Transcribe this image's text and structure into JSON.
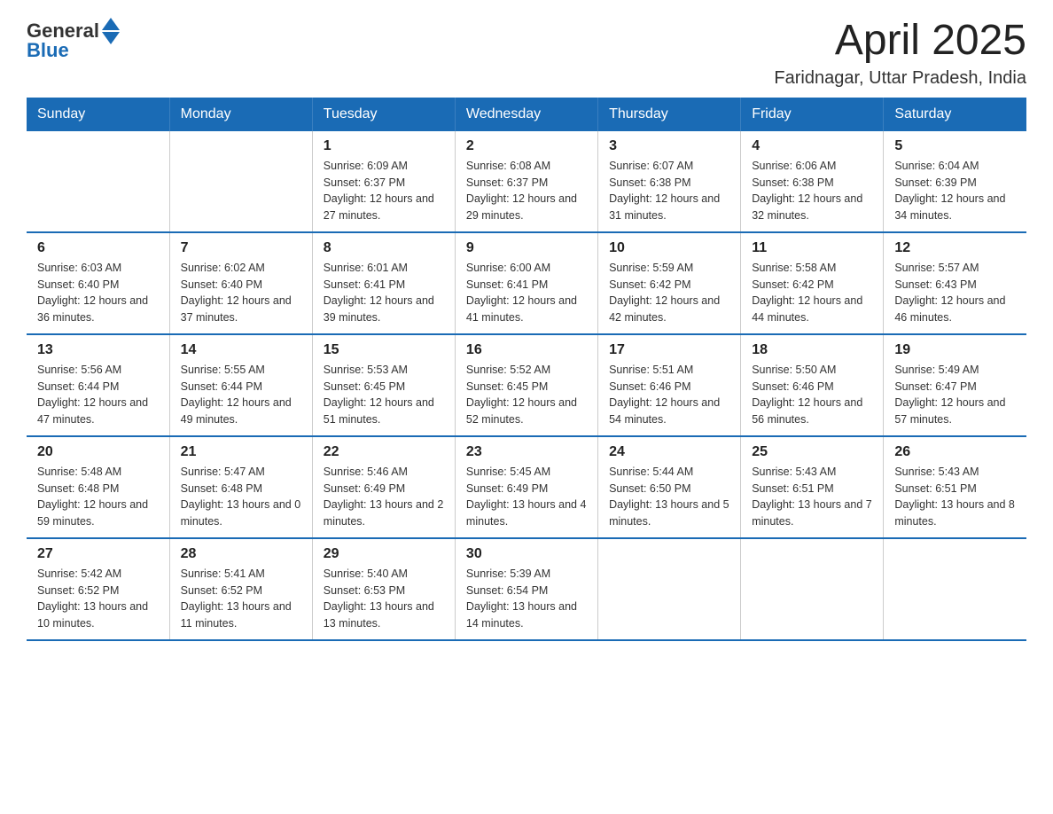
{
  "logo": {
    "general": "General",
    "blue": "Blue"
  },
  "title": "April 2025",
  "subtitle": "Faridnagar, Uttar Pradesh, India",
  "weekdays": [
    "Sunday",
    "Monday",
    "Tuesday",
    "Wednesday",
    "Thursday",
    "Friday",
    "Saturday"
  ],
  "weeks": [
    [
      {
        "day": "",
        "sunrise": "",
        "sunset": "",
        "daylight": ""
      },
      {
        "day": "",
        "sunrise": "",
        "sunset": "",
        "daylight": ""
      },
      {
        "day": "1",
        "sunrise": "Sunrise: 6:09 AM",
        "sunset": "Sunset: 6:37 PM",
        "daylight": "Daylight: 12 hours and 27 minutes."
      },
      {
        "day": "2",
        "sunrise": "Sunrise: 6:08 AM",
        "sunset": "Sunset: 6:37 PM",
        "daylight": "Daylight: 12 hours and 29 minutes."
      },
      {
        "day": "3",
        "sunrise": "Sunrise: 6:07 AM",
        "sunset": "Sunset: 6:38 PM",
        "daylight": "Daylight: 12 hours and 31 minutes."
      },
      {
        "day": "4",
        "sunrise": "Sunrise: 6:06 AM",
        "sunset": "Sunset: 6:38 PM",
        "daylight": "Daylight: 12 hours and 32 minutes."
      },
      {
        "day": "5",
        "sunrise": "Sunrise: 6:04 AM",
        "sunset": "Sunset: 6:39 PM",
        "daylight": "Daylight: 12 hours and 34 minutes."
      }
    ],
    [
      {
        "day": "6",
        "sunrise": "Sunrise: 6:03 AM",
        "sunset": "Sunset: 6:40 PM",
        "daylight": "Daylight: 12 hours and 36 minutes."
      },
      {
        "day": "7",
        "sunrise": "Sunrise: 6:02 AM",
        "sunset": "Sunset: 6:40 PM",
        "daylight": "Daylight: 12 hours and 37 minutes."
      },
      {
        "day": "8",
        "sunrise": "Sunrise: 6:01 AM",
        "sunset": "Sunset: 6:41 PM",
        "daylight": "Daylight: 12 hours and 39 minutes."
      },
      {
        "day": "9",
        "sunrise": "Sunrise: 6:00 AM",
        "sunset": "Sunset: 6:41 PM",
        "daylight": "Daylight: 12 hours and 41 minutes."
      },
      {
        "day": "10",
        "sunrise": "Sunrise: 5:59 AM",
        "sunset": "Sunset: 6:42 PM",
        "daylight": "Daylight: 12 hours and 42 minutes."
      },
      {
        "day": "11",
        "sunrise": "Sunrise: 5:58 AM",
        "sunset": "Sunset: 6:42 PM",
        "daylight": "Daylight: 12 hours and 44 minutes."
      },
      {
        "day": "12",
        "sunrise": "Sunrise: 5:57 AM",
        "sunset": "Sunset: 6:43 PM",
        "daylight": "Daylight: 12 hours and 46 minutes."
      }
    ],
    [
      {
        "day": "13",
        "sunrise": "Sunrise: 5:56 AM",
        "sunset": "Sunset: 6:44 PM",
        "daylight": "Daylight: 12 hours and 47 minutes."
      },
      {
        "day": "14",
        "sunrise": "Sunrise: 5:55 AM",
        "sunset": "Sunset: 6:44 PM",
        "daylight": "Daylight: 12 hours and 49 minutes."
      },
      {
        "day": "15",
        "sunrise": "Sunrise: 5:53 AM",
        "sunset": "Sunset: 6:45 PM",
        "daylight": "Daylight: 12 hours and 51 minutes."
      },
      {
        "day": "16",
        "sunrise": "Sunrise: 5:52 AM",
        "sunset": "Sunset: 6:45 PM",
        "daylight": "Daylight: 12 hours and 52 minutes."
      },
      {
        "day": "17",
        "sunrise": "Sunrise: 5:51 AM",
        "sunset": "Sunset: 6:46 PM",
        "daylight": "Daylight: 12 hours and 54 minutes."
      },
      {
        "day": "18",
        "sunrise": "Sunrise: 5:50 AM",
        "sunset": "Sunset: 6:46 PM",
        "daylight": "Daylight: 12 hours and 56 minutes."
      },
      {
        "day": "19",
        "sunrise": "Sunrise: 5:49 AM",
        "sunset": "Sunset: 6:47 PM",
        "daylight": "Daylight: 12 hours and 57 minutes."
      }
    ],
    [
      {
        "day": "20",
        "sunrise": "Sunrise: 5:48 AM",
        "sunset": "Sunset: 6:48 PM",
        "daylight": "Daylight: 12 hours and 59 minutes."
      },
      {
        "day": "21",
        "sunrise": "Sunrise: 5:47 AM",
        "sunset": "Sunset: 6:48 PM",
        "daylight": "Daylight: 13 hours and 0 minutes."
      },
      {
        "day": "22",
        "sunrise": "Sunrise: 5:46 AM",
        "sunset": "Sunset: 6:49 PM",
        "daylight": "Daylight: 13 hours and 2 minutes."
      },
      {
        "day": "23",
        "sunrise": "Sunrise: 5:45 AM",
        "sunset": "Sunset: 6:49 PM",
        "daylight": "Daylight: 13 hours and 4 minutes."
      },
      {
        "day": "24",
        "sunrise": "Sunrise: 5:44 AM",
        "sunset": "Sunset: 6:50 PM",
        "daylight": "Daylight: 13 hours and 5 minutes."
      },
      {
        "day": "25",
        "sunrise": "Sunrise: 5:43 AM",
        "sunset": "Sunset: 6:51 PM",
        "daylight": "Daylight: 13 hours and 7 minutes."
      },
      {
        "day": "26",
        "sunrise": "Sunrise: 5:43 AM",
        "sunset": "Sunset: 6:51 PM",
        "daylight": "Daylight: 13 hours and 8 minutes."
      }
    ],
    [
      {
        "day": "27",
        "sunrise": "Sunrise: 5:42 AM",
        "sunset": "Sunset: 6:52 PM",
        "daylight": "Daylight: 13 hours and 10 minutes."
      },
      {
        "day": "28",
        "sunrise": "Sunrise: 5:41 AM",
        "sunset": "Sunset: 6:52 PM",
        "daylight": "Daylight: 13 hours and 11 minutes."
      },
      {
        "day": "29",
        "sunrise": "Sunrise: 5:40 AM",
        "sunset": "Sunset: 6:53 PM",
        "daylight": "Daylight: 13 hours and 13 minutes."
      },
      {
        "day": "30",
        "sunrise": "Sunrise: 5:39 AM",
        "sunset": "Sunset: 6:54 PM",
        "daylight": "Daylight: 13 hours and 14 minutes."
      },
      {
        "day": "",
        "sunrise": "",
        "sunset": "",
        "daylight": ""
      },
      {
        "day": "",
        "sunrise": "",
        "sunset": "",
        "daylight": ""
      },
      {
        "day": "",
        "sunrise": "",
        "sunset": "",
        "daylight": ""
      }
    ]
  ]
}
